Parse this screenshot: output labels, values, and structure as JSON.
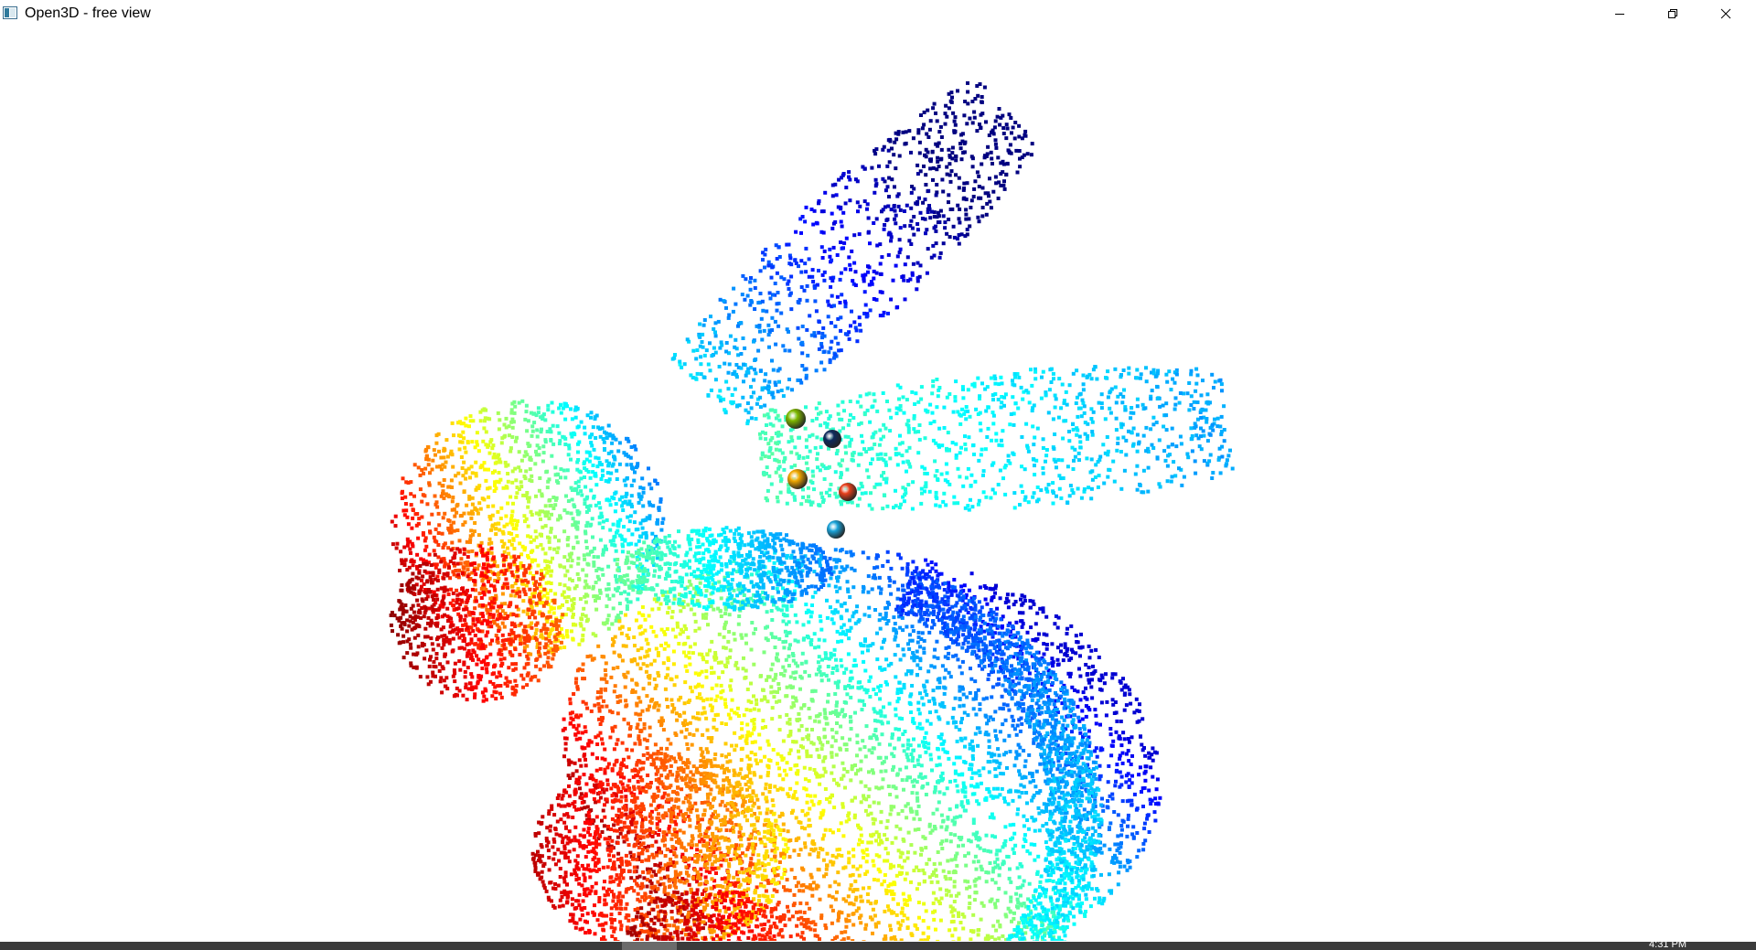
{
  "window": {
    "title": "Open3D - free view",
    "controls": {
      "minimize_icon": "minimize-icon",
      "maximize_icon": "restore-icon",
      "close_icon": "close-icon"
    }
  },
  "scene": {
    "background": "#ffffff",
    "colormap": "jet",
    "description_icon": "point-cloud",
    "picked_point_colors": [
      "#7fb800",
      "#0d2a5c",
      "#f2a800",
      "#e8401c",
      "#1aa3d9"
    ]
  },
  "taskbar": {
    "clock_partial": "4:31 PM"
  }
}
